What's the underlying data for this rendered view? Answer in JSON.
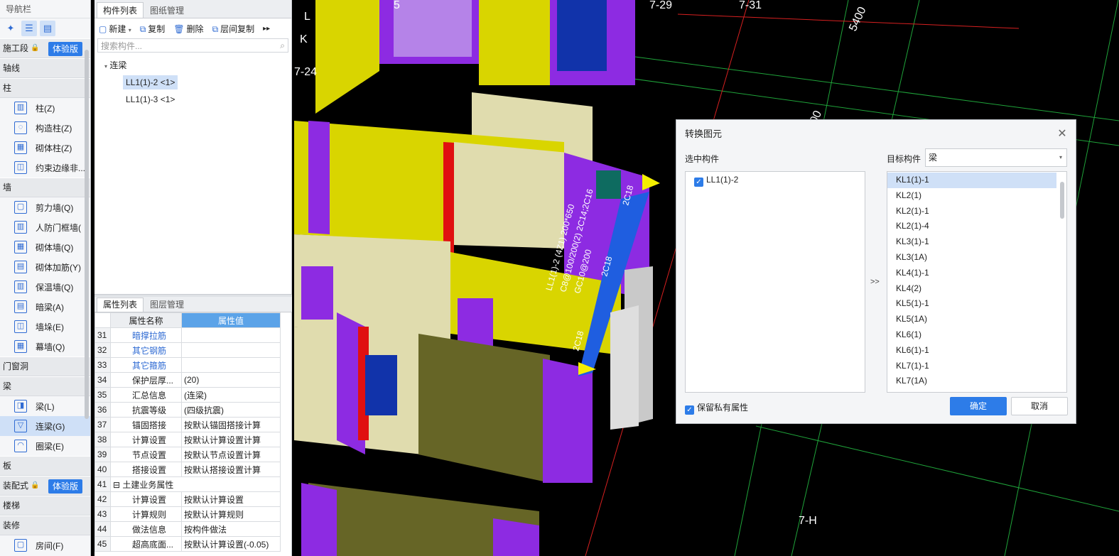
{
  "nav": {
    "title": "导航栏",
    "categories": [
      {
        "label": "施工段",
        "locked": true,
        "trial": "体验版"
      },
      {
        "label": "轴线"
      },
      {
        "label": "柱",
        "items": [
          "柱(Z)",
          "构造柱(Z)",
          "砌体柱(Z)",
          "约束边缘非..."
        ]
      },
      {
        "label": "墙",
        "items": [
          "剪力墙(Q)",
          "人防门框墙(",
          "砌体墙(Q)",
          "砌体加筋(Y)",
          "保温墙(Q)",
          "暗梁(A)",
          "墙垛(E)",
          "幕墙(Q)"
        ]
      },
      {
        "label": "门窗洞"
      },
      {
        "label": "梁",
        "items": [
          "梁(L)",
          "连梁(G)",
          "圈梁(E)"
        ]
      },
      {
        "label": "板"
      },
      {
        "label": "装配式",
        "locked": true,
        "trial": "体验版"
      },
      {
        "label": "楼梯"
      },
      {
        "label": "装修",
        "items": [
          "房间(F)"
        ]
      }
    ],
    "selected_item": "连梁(G)"
  },
  "component_panel": {
    "tabs": [
      "构件列表",
      "图纸管理"
    ],
    "toolbar": {
      "new": "新建",
      "copy": "复制",
      "delete": "删除",
      "floor_copy": "层间复制"
    },
    "search_placeholder": "搜索构件...",
    "tree_root": "连梁",
    "items": [
      "LL1(1)-2 <1>",
      "LL1(1)-3 <1>"
    ]
  },
  "property_panel": {
    "tabs": [
      "属性列表",
      "图层管理"
    ],
    "col_name": "属性名称",
    "col_value": "属性值",
    "rows": [
      {
        "n": "31",
        "name": "暗撑拉筋",
        "value": "",
        "blue": true
      },
      {
        "n": "32",
        "name": "其它钢筋",
        "value": "",
        "blue": true
      },
      {
        "n": "33",
        "name": "其它箍筋",
        "value": "",
        "blue": true
      },
      {
        "n": "34",
        "name": "保护层厚...",
        "value": "(20)"
      },
      {
        "n": "35",
        "name": "汇总信息",
        "value": "(连梁)"
      },
      {
        "n": "36",
        "name": "抗震等级",
        "value": "(四级抗震)"
      },
      {
        "n": "37",
        "name": "锚固搭接",
        "value": "按默认锚固搭接计算"
      },
      {
        "n": "38",
        "name": "计算设置",
        "value": "按默认计算设置计算"
      },
      {
        "n": "39",
        "name": "节点设置",
        "value": "按默认节点设置计算"
      },
      {
        "n": "40",
        "name": "搭接设置",
        "value": "按默认搭接设置计算"
      },
      {
        "n": "41",
        "name": "土建业务属性",
        "value": "",
        "group": true
      },
      {
        "n": "42",
        "name": "计算设置",
        "value": "按默认计算设置"
      },
      {
        "n": "43",
        "name": "计算规则",
        "value": "按默认计算规则"
      },
      {
        "n": "44",
        "name": "做法信息",
        "value": "按构件做法"
      },
      {
        "n": "45",
        "name": "超高底面...",
        "value": "按默认计算设置(-0.05)"
      }
    ]
  },
  "viewport": {
    "grid_labels": [
      "7-29",
      "7-31",
      "5400",
      "7-24",
      "7-H",
      "L",
      "K",
      "5",
      "00"
    ],
    "annotations": [
      "LL1(1)-2 (4Z1) 200*650",
      "C8@100/200(2) 2C14;2C16",
      "GC10@200",
      "2C18",
      "2C18",
      "2C18"
    ]
  },
  "dialog": {
    "title": "转换图元",
    "selected_label": "选中构件",
    "selected_item": "LL1(1)-2",
    "arrow": ">>",
    "target_label": "目标构件",
    "target_value": "梁",
    "target_items": [
      "KL1(1)-1",
      "KL2(1)",
      "KL2(1)-1",
      "KL2(1)-4",
      "KL3(1)-1",
      "KL3(1A)",
      "KL4(1)-1",
      "KL4(2)",
      "KL5(1)-1",
      "KL5(1A)",
      "KL6(1)",
      "KL6(1)-1",
      "KL7(1)-1",
      "KL7(1A)"
    ],
    "keep_private": "保留私有属性",
    "ok": "确定",
    "cancel": "取消",
    "accent": "#2d7ce8"
  }
}
